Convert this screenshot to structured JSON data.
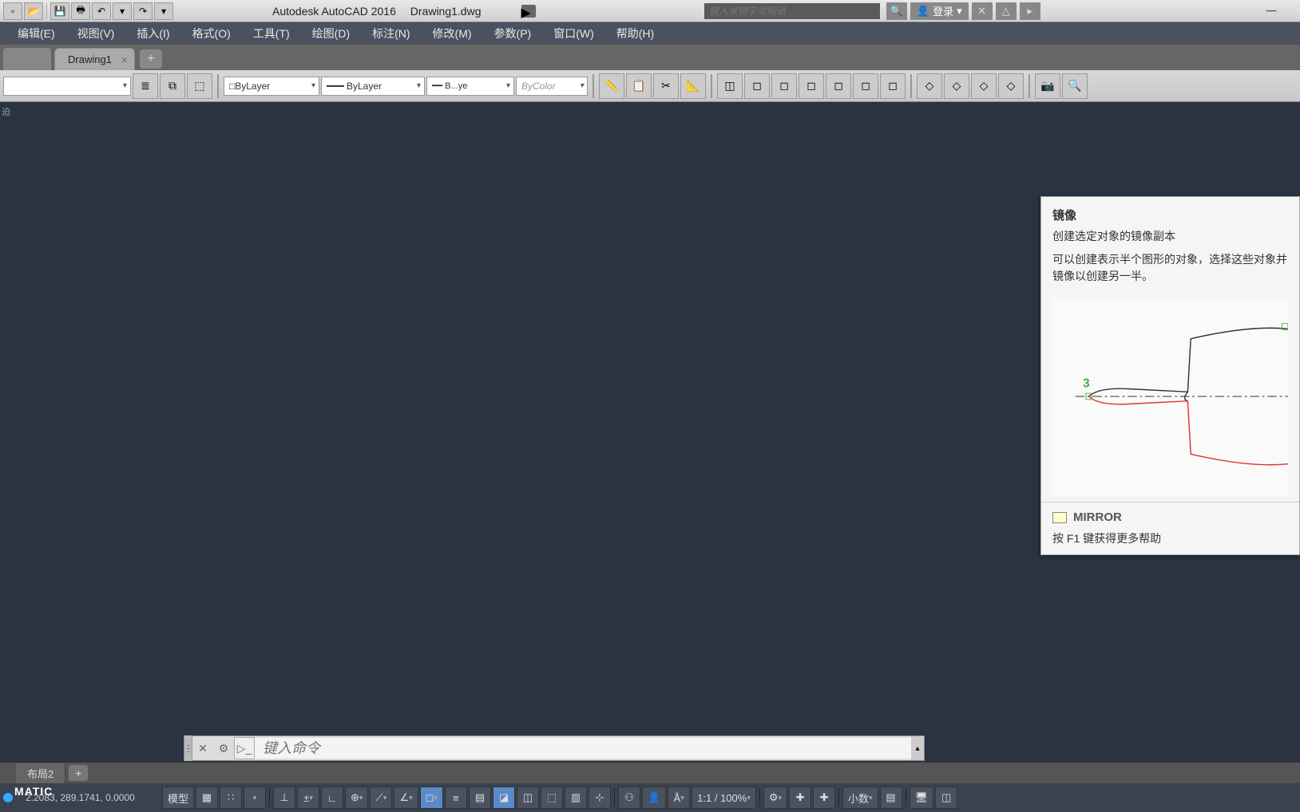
{
  "title_bar": {
    "app_name": "Autodesk AutoCAD 2016",
    "file_name": "Drawing1.dwg",
    "search_placeholder": "键入关键字或短语",
    "login": "登录"
  },
  "menu": {
    "edit": "编辑(E)",
    "view": "视图(V)",
    "insert": "插入(I)",
    "format": "格式(O)",
    "tools": "工具(T)",
    "draw": "绘图(D)",
    "dimension": "标注(N)",
    "modify": "修改(M)",
    "parametric": "参数(P)",
    "window": "窗口(W)",
    "help": "帮助(H)"
  },
  "tabs": {
    "drawing1": "Drawing1"
  },
  "ribbon": {
    "layer_combo": "",
    "color_combo": "□ByLayer",
    "linetype_combo": "━━━ ByLayer",
    "lineweight_combo": "━━ B...ye",
    "plotstyle_combo": "ByColor"
  },
  "canvas_marker": "迫",
  "tooltip": {
    "title": "镜像",
    "desc1": "创建选定对象的镜像副本",
    "desc2": "可以创建表示半个图形的对象，选择这些对象并镜像以创建另一半。",
    "label3": "3",
    "command": "MIRROR",
    "help": "按 F1 键获得更多帮助"
  },
  "command_line": {
    "placeholder": "键入命令"
  },
  "layout_tabs": {
    "layout2": "布局2"
  },
  "status": {
    "watermark": "MATIC",
    "coords": "2.2083, 289.1741, 0.0000",
    "model": "模型",
    "scale": "1:1 / 100%",
    "decimal": "小数"
  }
}
